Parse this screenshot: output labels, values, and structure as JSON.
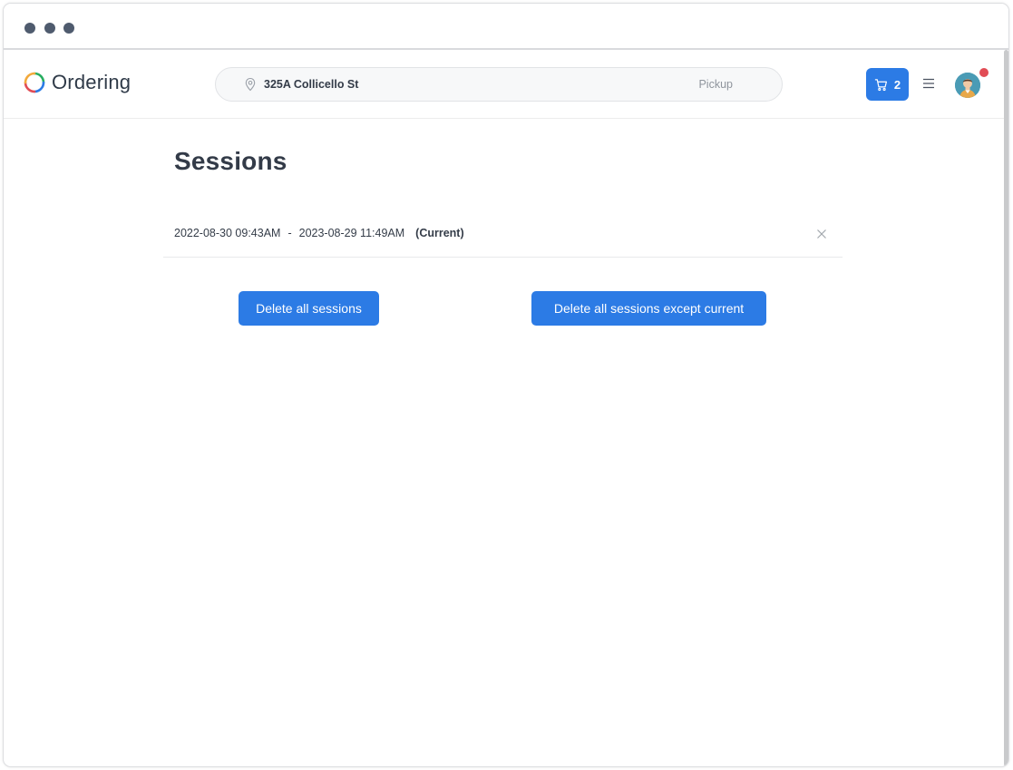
{
  "colors": {
    "accent": "#2c7be5",
    "window_dot": "#4f5b6e",
    "notification": "#e14c55"
  },
  "header": {
    "logo_text": "Ordering",
    "address": "325A Collicello St",
    "order_type": "Pickup",
    "cart_count": "2",
    "icons": [
      "location-pin-icon",
      "cart-icon",
      "hamburger-menu-icon",
      "user-avatar"
    ]
  },
  "main": {
    "title": "Sessions",
    "sessions": [
      {
        "start": "2022-08-30 09:43AM",
        "separator": "-",
        "end": "2023-08-29 11:49AM",
        "badge": "(Current)"
      }
    ],
    "delete_all_label": "Delete all sessions",
    "delete_except_label": "Delete all sessions except current"
  }
}
